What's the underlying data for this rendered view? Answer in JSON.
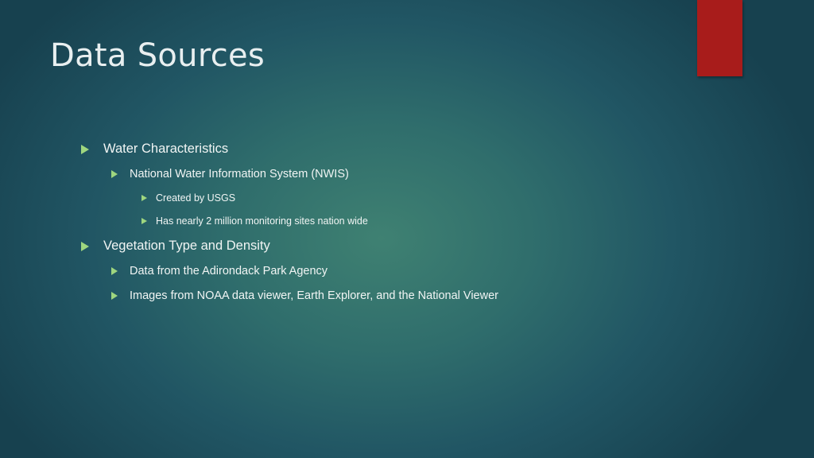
{
  "slide": {
    "title": "Data Sources",
    "accent_color": "#a81c1b",
    "bullet_icon": "triangle-right-icon",
    "bullets": [
      {
        "level": 1,
        "text": "Water Characteristics"
      },
      {
        "level": 2,
        "text": "National Water Information System (NWIS)"
      },
      {
        "level": 3,
        "text": "Created by USGS"
      },
      {
        "level": 3,
        "text": "Has nearly 2 million monitoring sites nation wide"
      },
      {
        "level": 1,
        "text": "Vegetation Type and Density"
      },
      {
        "level": 2,
        "text": "Data from the Adirondack Park Agency"
      },
      {
        "level": 2,
        "text": "Images from NOAA data viewer, Earth Explorer, and the National Viewer"
      }
    ]
  }
}
